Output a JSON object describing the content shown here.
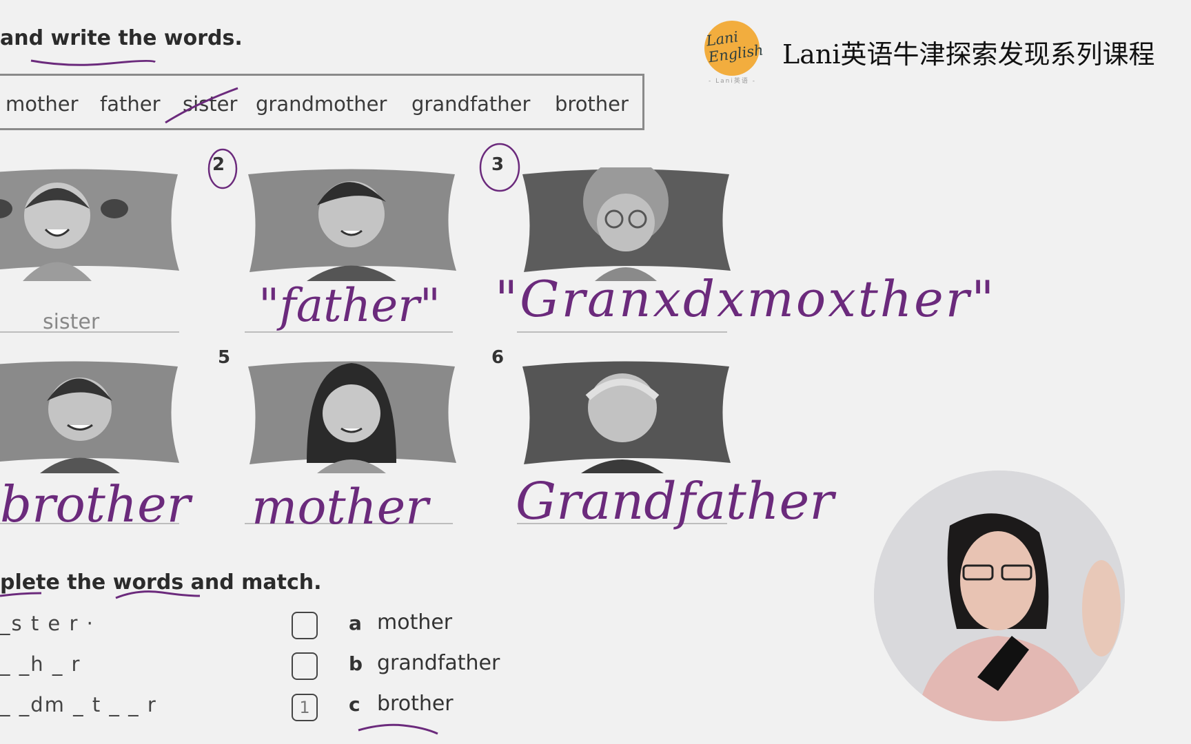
{
  "header": {
    "instruction_1": "and write the words.",
    "course_title": "Lani英语牛津探索发现系列课程",
    "logo_text": "Lani English",
    "logo_sub": "- Lani英语 -"
  },
  "word_bank": [
    "mother",
    "father",
    "sister",
    "grandmother",
    "grandfather",
    "brother"
  ],
  "pictures": [
    {
      "number": "",
      "person": "girl",
      "printed_answer": "sister",
      "handwritten": ""
    },
    {
      "number": "2",
      "person": "man",
      "printed_answer": "",
      "handwritten": "\"father\""
    },
    {
      "number": "3",
      "person": "grandmother",
      "printed_answer": "",
      "handwritten": "\"Granxdxmoxther\""
    },
    {
      "number": "",
      "person": "boy",
      "printed_answer": "",
      "handwritten": "brother"
    },
    {
      "number": "5",
      "person": "woman",
      "printed_answer": "",
      "handwritten": "mother"
    },
    {
      "number": "6",
      "person": "grandfather",
      "printed_answer": "",
      "handwritten": "Grandfather"
    }
  ],
  "section_2": {
    "instruction": "plete the words and match.",
    "rows": [
      {
        "puzzle": "_s t e r ·",
        "box": "",
        "letter": "a",
        "option": "mother"
      },
      {
        "puzzle": "_ _h _ r",
        "box": "",
        "letter": "b",
        "option": "grandfather"
      },
      {
        "puzzle": "_ _dm _ t _ _ r",
        "box": "1",
        "letter": "c",
        "option": "brother"
      }
    ]
  },
  "colors": {
    "ink": "#6b2a7c",
    "logo": "#f2ad3e",
    "background": "#f1f1f1"
  }
}
